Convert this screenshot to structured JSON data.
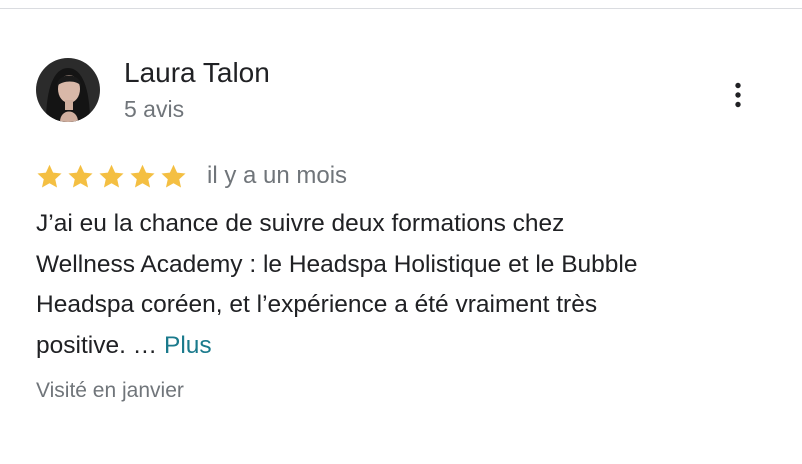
{
  "review": {
    "author_name": "Laura Talon",
    "review_count": "5 avis",
    "rating": 5,
    "rating_max": 5,
    "star_color": "#f4bf42",
    "date": "il y a un mois",
    "text_lines": [
      "J’ai eu la chance de suivre deux formations chez",
      "Wellness Academy : le Headspa Holistique et le Bubble",
      "Headspa coréen, et l’expérience a été vraiment très",
      "positive. …"
    ],
    "more_label": "Plus",
    "visited": "Visité en janvier",
    "link_color": "#1a7a8c"
  },
  "icons": {
    "menu": "more-vert-icon",
    "star": "star-icon"
  }
}
